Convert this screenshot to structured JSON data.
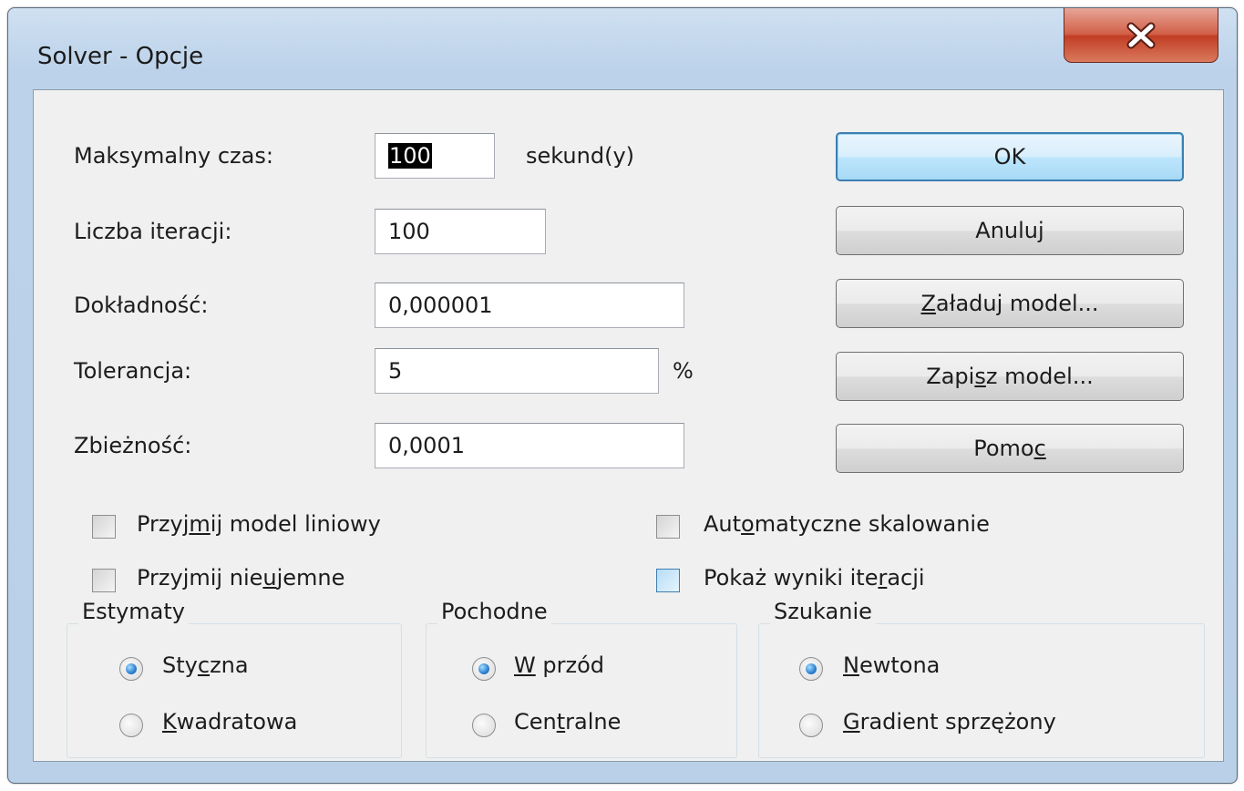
{
  "window": {
    "title": "Solver - Opcje"
  },
  "fields": {
    "max_time": {
      "label": "Maksymalny czas:",
      "value": "100",
      "unit": "sekund(y)"
    },
    "iterations": {
      "label": "Liczba iteracji:",
      "value": "100"
    },
    "precision": {
      "label": "Dokładność:",
      "value": "0,000001"
    },
    "tolerance": {
      "label": "Tolerancja:",
      "value": "5",
      "unit": "%"
    },
    "convergence": {
      "label": "Zbieżność:",
      "value": "0,0001"
    }
  },
  "buttons": {
    "ok": "OK",
    "cancel": "Anuluj",
    "load": {
      "pre": "",
      "u": "Z",
      "post": "aładuj model..."
    },
    "save": {
      "pre": "Zapi",
      "u": "s",
      "post": "z model..."
    },
    "help": {
      "pre": "Pomo",
      "u": "c",
      "post": ""
    }
  },
  "checkboxes": {
    "linear": {
      "pre": "Przyj",
      "u": "m",
      "post": "ij model liniowy",
      "checked": false
    },
    "nonneg": {
      "pre": "Przyjmij nie",
      "u": "u",
      "post": "jemne",
      "checked": false
    },
    "autoscale": {
      "pre": "Aut",
      "u": "o",
      "post": "matyczne skalowanie",
      "checked": false
    },
    "show_iter": {
      "pre": "Pokaż wyniki ite",
      "u": "r",
      "post": "acji",
      "checked": false
    }
  },
  "groups": {
    "estimates": {
      "title": "Estymaty",
      "opt1": {
        "pre": "Sty",
        "u": "c",
        "post": "zna",
        "selected": true
      },
      "opt2": {
        "pre": "",
        "u": "K",
        "post": "wadratowa",
        "selected": false
      }
    },
    "derivatives": {
      "title": "Pochodne",
      "opt1": {
        "pre": "",
        "u": "W",
        "post": " przód",
        "selected": true
      },
      "opt2": {
        "pre": "Cen",
        "u": "t",
        "post": "ralne",
        "selected": false
      }
    },
    "search": {
      "title": "Szukanie",
      "opt1": {
        "pre": "",
        "u": "N",
        "post": "ewtona",
        "selected": true
      },
      "opt2": {
        "pre": "",
        "u": "G",
        "post": "radient sprzężony",
        "selected": false
      }
    }
  }
}
